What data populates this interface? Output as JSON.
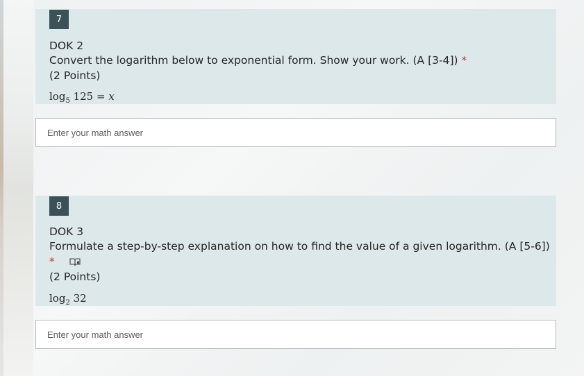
{
  "questions": [
    {
      "number": "7",
      "dok": "DOK 2",
      "prompt": "Convert the logarithm below to exponential form. Show your work. (A [3-4])",
      "required_mark": "*",
      "points": "(2 Points)",
      "math": {
        "fn": "log",
        "base": "5",
        "arg": "125",
        "rhs": "= x"
      },
      "answer_placeholder": "Enter your math answer"
    },
    {
      "number": "8",
      "dok": "DOK 3",
      "prompt": "Formulate a step-by-step explanation on how to find the value of a given logarithm.  (A [5-6])",
      "required_mark": "*",
      "points": "(2 Points)",
      "math": {
        "fn": "log",
        "base": "2",
        "arg": "32"
      },
      "answer_placeholder": "Enter your math answer",
      "icon": "immersive-reader-icon"
    }
  ],
  "colors": {
    "panel": "#dde8ea",
    "badge": "#3a5157",
    "required": "#c03a2b"
  }
}
